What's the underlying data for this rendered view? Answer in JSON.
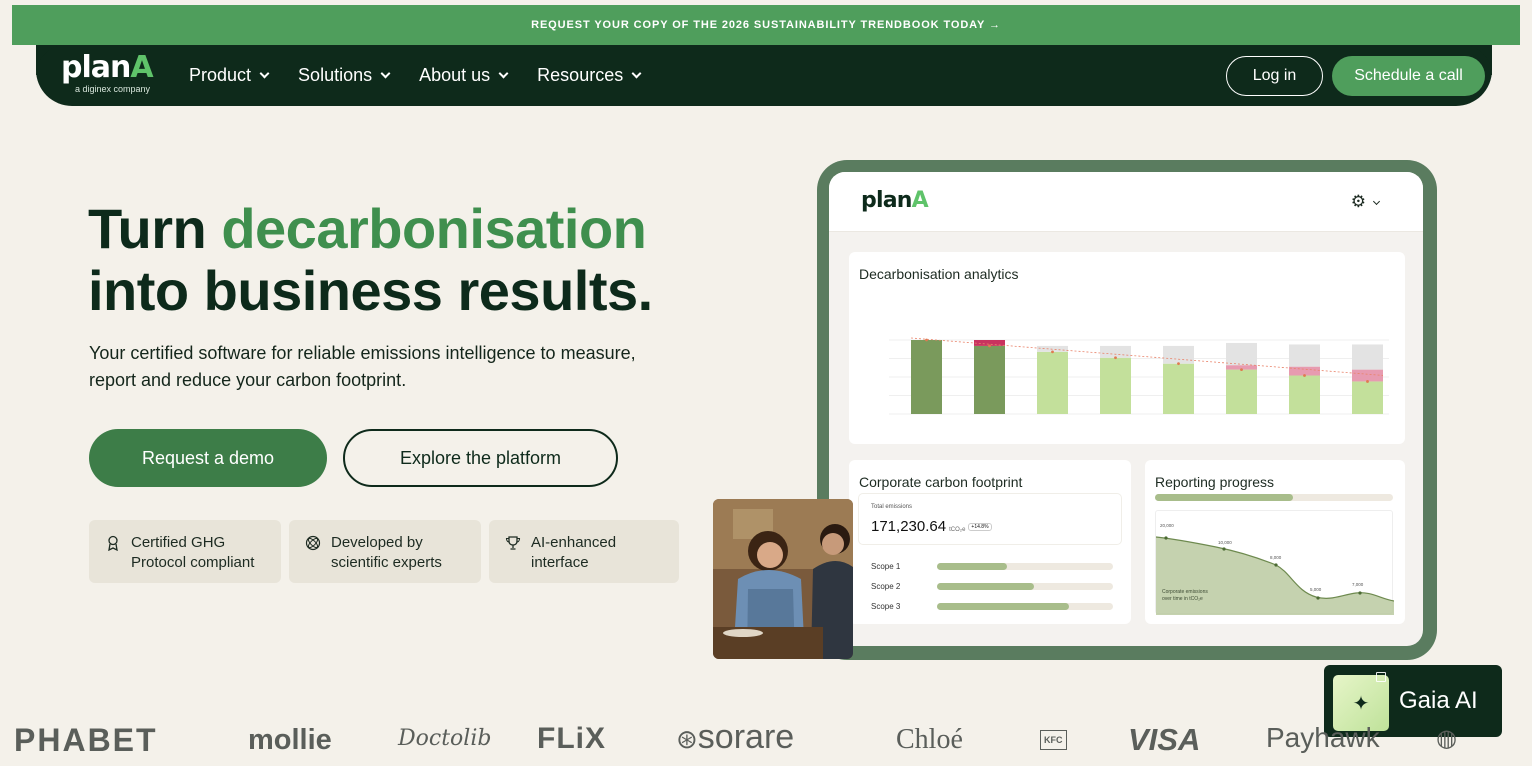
{
  "banner": {
    "text": "REQUEST YOUR COPY OF THE 2026 SUSTAINABILITY TRENDBOOK TODAY →"
  },
  "nav": {
    "logo_main": "plan",
    "logo_accent": "A",
    "logo_sub": "a diginex company",
    "menu": [
      {
        "label": "Product"
      },
      {
        "label": "Solutions"
      },
      {
        "label": "About us"
      },
      {
        "label": "Resources"
      }
    ],
    "login": "Log in",
    "schedule": "Schedule a call"
  },
  "hero": {
    "headline_1a": "Turn ",
    "headline_1b": "decarbonisation",
    "headline_2": "into business results.",
    "subtitle": "Your certified software for reliable emissions intelligence to measure, report and reduce your carbon footprint.",
    "demo_btn": "Request a demo",
    "explore_btn": "Explore the platform",
    "badges": [
      {
        "line1": "Certified GHG",
        "line2": "Protocol compliant",
        "icon": "award-ribbon-icon"
      },
      {
        "line1": "Developed by",
        "line2": "scientific experts",
        "icon": "atom-icon"
      },
      {
        "line1": "AI-enhanced",
        "line2": "interface",
        "icon": "trophy-icon"
      }
    ]
  },
  "dashboard": {
    "logo_main": "plan",
    "logo_accent": "A",
    "analytics_title": "Decarbonisation analytics",
    "footprint_title": "Corporate carbon footprint",
    "total_label": "Total emissions",
    "total_value": "171,230.64",
    "total_unit": "tCO₂e",
    "total_change": "+14.8%",
    "scopes": [
      {
        "label": "Scope 1",
        "fill": 0.4
      },
      {
        "label": "Scope 2",
        "fill": 0.55
      },
      {
        "label": "Scope 3",
        "fill": 0.75
      }
    ],
    "reporting_title": "Reporting progress",
    "reporting_fill": 0.58,
    "mini_labels": [
      "20,000",
      "10,000",
      "8,000",
      "5,000",
      "7,000"
    ],
    "mini_caption_1": "Corporate emissions",
    "mini_caption_2": "over time in tCO₂e",
    "bars": [
      {
        "dark": 1.0,
        "pink": 0.0,
        "grey": 0.0
      },
      {
        "dark": 0.92,
        "pink": 0.08,
        "grey": 0.0
      },
      {
        "dark": 0.84,
        "pink": 0.0,
        "grey": 0.08
      },
      {
        "dark": 0.76,
        "pink": 0.0,
        "grey": 0.16
      },
      {
        "dark": 0.68,
        "pink": 0.0,
        "grey": 0.24
      },
      {
        "dark": 0.6,
        "pink": 0.06,
        "grey": 0.3
      },
      {
        "dark": 0.52,
        "pink": 0.12,
        "grey": 0.3
      },
      {
        "dark": 0.44,
        "pink": 0.16,
        "grey": 0.34
      }
    ]
  },
  "gaia": {
    "label": "Gaia AI"
  },
  "logos": [
    "PHABET",
    "mollie",
    "Doctolib",
    "FLiX",
    "sorare",
    "Chloé",
    "KFC",
    "VISA",
    "Payhawk"
  ]
}
